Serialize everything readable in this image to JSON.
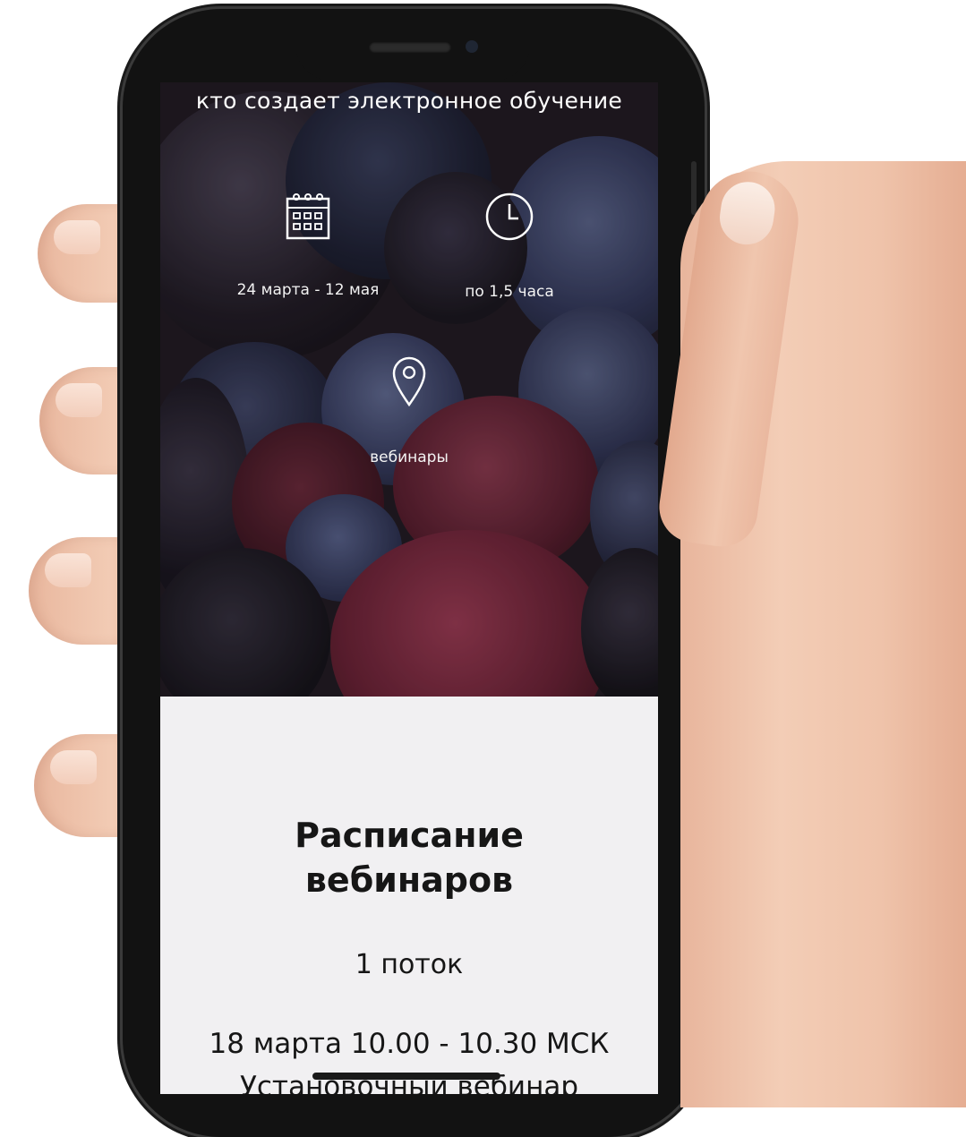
{
  "hero": {
    "subtitle": "кто создает электронное обучение",
    "items": [
      {
        "icon": "calendar-icon",
        "label": "24 марта - 12 мая"
      },
      {
        "icon": "clock-icon",
        "label": "по 1,5 часа"
      },
      {
        "icon": "location-pin-icon",
        "label": "вебинары"
      }
    ]
  },
  "schedule": {
    "title_line1": "Расписание",
    "title_line2": "вебинаров",
    "stream": "1 поток",
    "first_session": "18 марта 10.00 - 10.30 МСК",
    "first_session_desc": "Установочный вебинар"
  },
  "colors": {
    "screen_bg": "#f1f0f2",
    "hero_text": "#ffffff",
    "title_text": "#161616"
  }
}
